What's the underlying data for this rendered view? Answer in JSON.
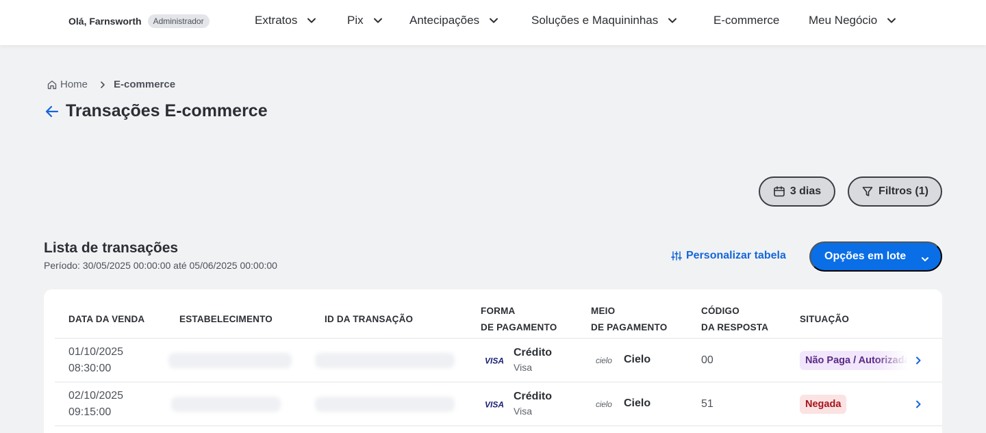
{
  "header": {
    "greeting": "Olá, Farnsworth",
    "role_badge": "Administrador",
    "nav": [
      {
        "label": "Extratos",
        "has_dropdown": true
      },
      {
        "label": "Pix",
        "has_dropdown": true
      },
      {
        "label": "Antecipações",
        "has_dropdown": true
      },
      {
        "label": "Soluções e Maquininhas",
        "has_dropdown": true
      },
      {
        "label": "E-commerce",
        "has_dropdown": false
      },
      {
        "label": "Meu Negócio",
        "has_dropdown": true
      }
    ]
  },
  "breadcrumb": {
    "home": "Home",
    "current": "E-commerce"
  },
  "page": {
    "title": "Transações E-commerce"
  },
  "filters": {
    "date_range_label": "3 dias",
    "filters_label": "Filtros (1)"
  },
  "list": {
    "title": "Lista de transações",
    "period": "Período: 30/05/2025 00:00:00 até 05/06/2025 00:00:00",
    "customize_label": "Personalizar tabela",
    "bulk_options_label": "Opções em lote"
  },
  "table": {
    "columns": [
      {
        "line1": "DATA DA VENDA",
        "line2": ""
      },
      {
        "line1": "ESTABELECIMENTO",
        "line2": ""
      },
      {
        "line1": "ID DA TRANSAÇÃO",
        "line2": ""
      },
      {
        "line1": "FORMA",
        "line2": "DE PAGAMENTO"
      },
      {
        "line1": "MEIO",
        "line2": "DE PAGAMENTO"
      },
      {
        "line1": "CÓDIGO",
        "line2": "DA RESPOSTA"
      },
      {
        "line1": "SITUAÇÃO",
        "line2": ""
      }
    ],
    "rows": [
      {
        "date": "01/10/2025",
        "time": "08:30:00",
        "card_brand_logo": "VISA",
        "payment_type": "Crédito",
        "payment_brand": "Visa",
        "acquirer_logo": "cielo",
        "acquirer": "Cielo",
        "response_code": "00",
        "status": "Não Paga / Autorizada",
        "status_kind": "pending"
      },
      {
        "date": "02/10/2025",
        "time": "09:15:00",
        "card_brand_logo": "VISA",
        "payment_type": "Crédito",
        "payment_brand": "Visa",
        "acquirer_logo": "cielo",
        "acquirer": "Cielo",
        "response_code": "51",
        "status": "Negada",
        "status_kind": "denied"
      }
    ]
  },
  "colors": {
    "primary": "#0a6ee6",
    "link": "#1466d9",
    "background": "#f1f2f4",
    "status_pending_bg": "#f1e6fb",
    "status_pending_text": "#5b2b86",
    "status_denied_bg": "#fbe2e3",
    "status_denied_text": "#a3151c"
  }
}
